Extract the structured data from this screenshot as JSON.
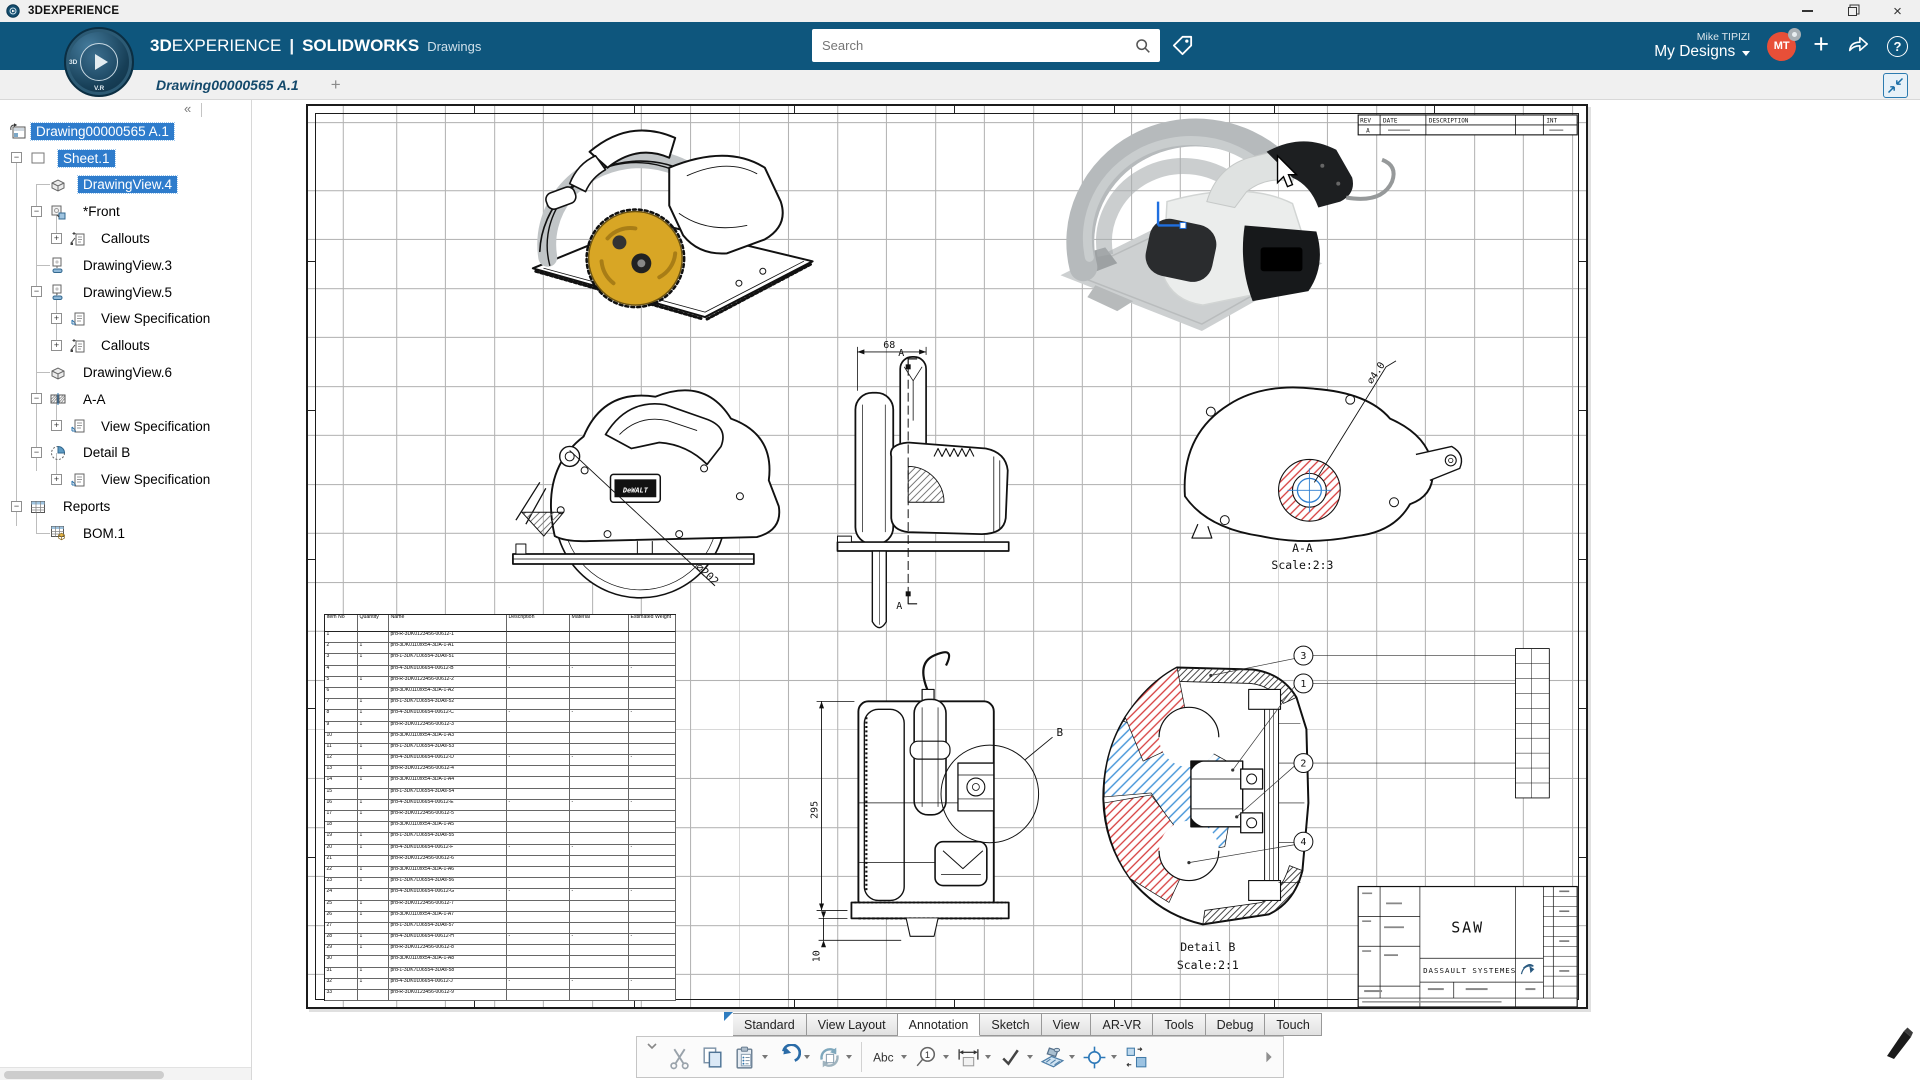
{
  "window": {
    "title": "3DEXPERIENCE"
  },
  "appbar": {
    "brand_3d": "3D",
    "brand_experience": "EXPERIENCE",
    "separator": "|",
    "brand_product": "SOLIDWORKS",
    "brand_module": "Drawings",
    "search_placeholder": "Search",
    "user_name": "Mike TIPIZI",
    "workspace_label": "My Designs",
    "avatar_initials": "MT",
    "plus_label": "+",
    "help_label": "?",
    "badge_3d": "3D",
    "badge_vr": "V.R",
    "accent_blue": "#0e567d",
    "avatar_red": "#e84f38"
  },
  "tabbar": {
    "document_tab": "Drawing00000565 A.1",
    "new_tab_label": "+"
  },
  "sidebar_collapse": "«",
  "tree": {
    "items": [
      {
        "label": "Drawing00000565 A.1",
        "level": 0,
        "icon": "drawing-root",
        "expander": "",
        "selected": true
      },
      {
        "label": "Sheet.1",
        "level": 1,
        "icon": "sheet",
        "expander": "-",
        "selected": true
      },
      {
        "label": "DrawingView.4",
        "level": 2,
        "icon": "view-iso",
        "expander": "",
        "selected": true
      },
      {
        "label": "*Front",
        "level": 2,
        "icon": "view-front",
        "expander": "-",
        "selected": false
      },
      {
        "label": "Callouts",
        "level": 3,
        "icon": "callouts",
        "expander": "+",
        "selected": false
      },
      {
        "label": "DrawingView.3",
        "level": 2,
        "icon": "view-proj",
        "expander": "",
        "selected": false
      },
      {
        "label": "DrawingView.5",
        "level": 2,
        "icon": "view-proj",
        "expander": "-",
        "selected": false
      },
      {
        "label": "View Specification",
        "level": 3,
        "icon": "view-spec",
        "expander": "+",
        "selected": false
      },
      {
        "label": "Callouts",
        "level": 3,
        "icon": "callouts",
        "expander": "+",
        "selected": false
      },
      {
        "label": "DrawingView.6",
        "level": 2,
        "icon": "view-iso",
        "expander": "",
        "selected": false
      },
      {
        "label": "A-A",
        "level": 2,
        "icon": "section",
        "expander": "-",
        "selected": false
      },
      {
        "label": "View Specification",
        "level": 3,
        "icon": "view-spec",
        "expander": "+",
        "selected": false
      },
      {
        "label": "Detail B",
        "level": 2,
        "icon": "detail",
        "expander": "-",
        "selected": false
      },
      {
        "label": "View Specification",
        "level": 3,
        "icon": "view-spec",
        "expander": "+",
        "selected": false
      },
      {
        "label": "Reports",
        "level": 1,
        "icon": "reports",
        "expander": "-",
        "selected": false
      },
      {
        "label": "BOM.1",
        "level": 2,
        "icon": "bom",
        "expander": "",
        "selected": false
      }
    ]
  },
  "sheet": {
    "revision_table": {
      "headers": [
        "REV",
        "DATE",
        "DESCRIPTION",
        "INT"
      ],
      "rev_value": "A"
    },
    "title_block": {
      "title": "SAW",
      "company": "DASSAULT SYSTEMES"
    },
    "views": {
      "front": {
        "brand": "DeWALT",
        "dim_diameter": "⌀202"
      },
      "side": {
        "dim": "68",
        "section_label": "A"
      },
      "section": {
        "label": "A-A",
        "scale": "Scale:2:3",
        "dim": "⌀4.0"
      },
      "rear": {
        "dim_height": "295",
        "dim_base": "10",
        "detail_label": "B"
      },
      "detail": {
        "label": "Detail B",
        "scale": "Scale:2:1",
        "balloons": [
          "3",
          "1",
          "2",
          "4"
        ]
      }
    },
    "bom": {
      "headers": [
        "Item No",
        "Quantity",
        "Name",
        "Description",
        "Material",
        "Estimated Weight"
      ],
      "rows": [
        [
          "1",
          "",
          "prd-R-3DK0123456-00612-1",
          0
        ],
        [
          "2",
          "1",
          "prd-3DK0110xx54-3DA-1-A1",
          0
        ],
        [
          "3",
          "1",
          "prd-1-3DK7L06554-3DAs-51",
          0
        ],
        [
          "4",
          "",
          "prd-4-3DK0106654-00612-B",
          1
        ],
        [
          "5",
          "1",
          "prd-R-3DK0123456-00612-2",
          0
        ],
        [
          "6",
          "",
          "prd-3DK0110xx54-3DA-1-A2",
          0
        ],
        [
          "7",
          "1",
          "prd-1-3DK7L06554-3DAs-52",
          0
        ],
        [
          "8",
          "1",
          "prd-4-3DK0106654-00612-C",
          1
        ],
        [
          "9",
          "1",
          "prd-R-3DK0123456-00612-3",
          0
        ],
        [
          "10",
          "",
          "prd-3DK0110xx54-3DA-1-A3",
          0
        ],
        [
          "11",
          "1",
          "prd-1-3DK7L06554-3DAs-53",
          0
        ],
        [
          "12",
          "",
          "prd-4-3DK0106654-00612-D",
          1
        ],
        [
          "13",
          "1",
          "prd-R-3DK0123456-00612-4",
          0
        ],
        [
          "14",
          "1",
          "prd-3DK0110xx54-3DA-1-A4",
          0
        ],
        [
          "15",
          "",
          "prd-1-3DK7L06554-3DAs-54",
          0
        ],
        [
          "16",
          "1",
          "prd-4-3DK0106654-00612-E",
          1
        ],
        [
          "17",
          "1",
          "prd-R-3DK0123456-00612-5",
          0
        ],
        [
          "18",
          "",
          "prd-3DK0110xx54-3DA-1-A5",
          0
        ],
        [
          "19",
          "1",
          "prd-1-3DK7L06554-3DAs-55",
          0
        ],
        [
          "20",
          "1",
          "prd-4-3DK0106654-00612-F",
          1
        ],
        [
          "21",
          "",
          "prd-R-3DK0123456-00612-6",
          0
        ],
        [
          "22",
          "1",
          "prd-3DK0110xx54-3DA-1-A6",
          0
        ],
        [
          "23",
          "1",
          "prd-1-3DK7L06554-3DAs-56",
          0
        ],
        [
          "24",
          "",
          "prd-4-3DK0106654-00612-G",
          1
        ],
        [
          "25",
          "1",
          "prd-R-3DK0123456-00612-7",
          0
        ],
        [
          "26",
          "1",
          "prd-3DK0110xx54-3DA-1-A7",
          0
        ],
        [
          "27",
          "",
          "prd-1-3DK7L06554-3DAs-57",
          0
        ],
        [
          "28",
          "1",
          "prd-4-3DK0106654-00612-H",
          1
        ],
        [
          "29",
          "1",
          "prd-R-3DK0123456-00612-8",
          0
        ],
        [
          "30",
          "",
          "prd-3DK0110xx54-3DA-1-A8",
          0
        ],
        [
          "31",
          "1",
          "prd-1-3DK7L06554-3DAs-58",
          0
        ],
        [
          "32",
          "1",
          "prd-4-3DK0106654-00612-J",
          1
        ],
        [
          "33",
          "",
          "prd-R-3DK0123456-00612-9",
          0
        ]
      ]
    }
  },
  "command_bar": {
    "tabs": [
      "Standard",
      "View Layout",
      "Annotation",
      "Sketch",
      "View",
      "AR-VR",
      "Tools",
      "Debug",
      "Touch"
    ],
    "active_tab": "Annotation",
    "buttons": [
      {
        "name": "expand-toolbar",
        "icon": "chevdown",
        "dropdown": false
      },
      {
        "name": "cut",
        "icon": "cut",
        "dropdown": false
      },
      {
        "name": "copy",
        "icon": "copy",
        "dropdown": false
      },
      {
        "name": "paste",
        "icon": "paste",
        "dropdown": true
      },
      {
        "name": "undo",
        "icon": "undo",
        "dropdown": true
      },
      {
        "name": "update-views",
        "icon": "rebuild",
        "dropdown": true
      },
      {
        "name": "separator",
        "icon": "sep",
        "dropdown": false
      },
      {
        "name": "note",
        "icon": "abc",
        "dropdown": true
      },
      {
        "name": "balloon",
        "icon": "balloon",
        "dropdown": true
      },
      {
        "name": "dimension",
        "icon": "dimension",
        "dropdown": true
      },
      {
        "name": "spell-check",
        "icon": "check",
        "dropdown": true
      },
      {
        "name": "area-hatch",
        "icon": "hatch",
        "dropdown": true
      },
      {
        "name": "centermark",
        "icon": "centermark",
        "dropdown": true
      },
      {
        "name": "auto-arrange-dimensions",
        "icon": "arrange",
        "dropdown": false
      },
      {
        "name": "more-tools",
        "icon": "chevright",
        "dropdown": false
      }
    ]
  }
}
